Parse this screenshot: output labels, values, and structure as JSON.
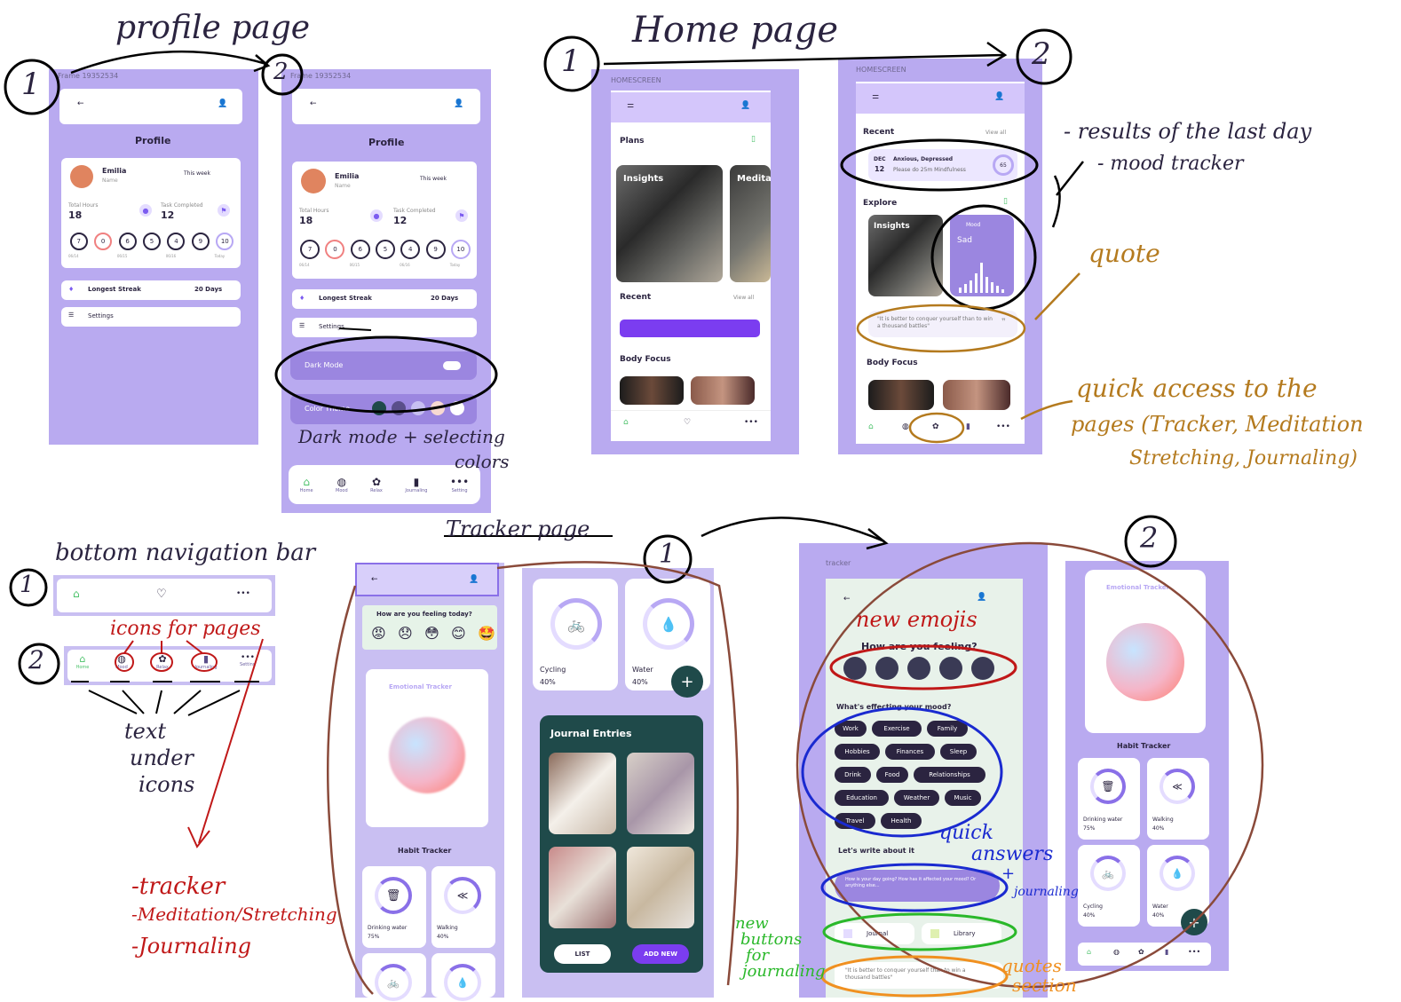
{
  "annotations": {
    "profile_page": "profile page",
    "home_page": "Home page",
    "tracker_page": "Tracker page",
    "bottom_nav_bar": "bottom navigation bar",
    "step1": "1",
    "step2": "2",
    "results_last_day": "- results of the last day",
    "mood_tracker": "- mood tracker",
    "quote": "quote",
    "quick_access": [
      "quick access to the",
      "pages (Tracker, Meditation",
      "Stretching, Journaling)"
    ],
    "dark_mode_colors": [
      "Dark mode + selecting",
      "colors"
    ],
    "icons_for_pages": "icons for pages",
    "text_under_icons": [
      "text",
      "under",
      "icons"
    ],
    "pages_list": [
      "-tracker",
      "-Meditation/Stretching",
      "-Journaling"
    ],
    "new_emojis": "new emojis",
    "quick_answers": [
      "quick",
      "answers",
      "+",
      "journaling"
    ],
    "new_buttons": [
      "new",
      "buttons",
      "for",
      "journaling"
    ],
    "quotes_section": [
      "quotes",
      "section"
    ]
  },
  "profile1": {
    "frame_label": "Frame 19352534",
    "title": "Profile",
    "name": "Emilia",
    "name_sub": "Name",
    "period": "This week",
    "hours_label": "Total Hours",
    "hours": "18",
    "tasks_label": "Task Completed",
    "tasks": "12",
    "days": [
      "7",
      "0",
      "6",
      "5",
      "4",
      "9",
      "10"
    ],
    "dates": [
      "06/14",
      "",
      "06/15",
      "",
      "06/16",
      "",
      "Today"
    ],
    "streak_label": "Longest Streak",
    "streak_value": "20 Days",
    "settings": "Settings"
  },
  "profile2": {
    "frame_label": "Frame 19352534",
    "title": "Profile",
    "name": "Emilia",
    "name_sub": "Name",
    "period": "This week",
    "hours_label": "Total Hours",
    "hours": "18",
    "tasks_label": "Task Completed",
    "tasks": "12",
    "days": [
      "7",
      "0",
      "6",
      "5",
      "4",
      "9",
      "10"
    ],
    "dates": [
      "06/14",
      "",
      "06/15",
      "",
      "06/16",
      "",
      "Today"
    ],
    "streak_label": "Longest Streak",
    "streak_value": "20 Days",
    "settings": "Settings",
    "dark_mode": "Dark Mode",
    "color_theme": "Color Theme",
    "theme_colors": [
      "#1f4a4a",
      "#5a4e8a",
      "#c7bff2",
      "#f7d9d2",
      "#ffffff"
    ],
    "nav": [
      "Home",
      "Mood",
      "Relax",
      "Journaling",
      "Setting"
    ]
  },
  "home1": {
    "frame_label": "HOMESCREEN",
    "plans": "Plans",
    "insights": "Insights",
    "meditate": "Medita",
    "recent": "Recent",
    "view_all": "View all",
    "body_focus": "Body Focus"
  },
  "home2": {
    "frame_label": "HOMESCREEN",
    "recent": "Recent",
    "view_all": "View all",
    "month": "DEC",
    "day": "12",
    "mood_title": "Anxious, Depressed",
    "mood_sub": "Please do 25m Mindfulness",
    "score": "65",
    "explore": "Explore",
    "insights": "Insights",
    "mood_label": "Mood",
    "mood_value": "Sad",
    "quote": "\"It is better to conquer yourself than to win a thousand battles\"",
    "body_focus": "Body Focus"
  },
  "tracker1": {
    "question": "How are you feeling today?",
    "emotional_tracker": "Emotional Tracker",
    "habit_tracker": "Habit Tracker",
    "drinking": "Drinking water",
    "drinking_pct": "75%",
    "walking": "Walking",
    "walking_pct": "40%",
    "cycling": "Cycling",
    "cycling_pct": "40%",
    "water": "Water",
    "water_pct": "40%",
    "journal_entries": "Journal Entries",
    "list": "LIST",
    "add_new": "ADD NEW"
  },
  "tracker2": {
    "frame_label": "tracker",
    "question": "How are you feeling?",
    "effect_q": "What's effecting your mood?",
    "chips": [
      "Work",
      "Exercise",
      "Family",
      "Hobbies",
      "Finances",
      "Sleep",
      "Drink",
      "Food",
      "Relationships",
      "Education",
      "Weather",
      "Music",
      "Travel",
      "Health"
    ],
    "write": "Let's write about it",
    "write_placeholder": "How is your day going? How has it affected your mood? Or anything else...",
    "journal": "Journal",
    "library": "Library",
    "quote": "\"It is better to conquer yourself than to win a thousand battles\"",
    "emotional_tracker": "Emotional Tracker",
    "habit_tracker": "Habit Tracker",
    "drinking": "Drinking water",
    "drinking_pct": "75%",
    "walking": "Walking",
    "walking_pct": "40%",
    "cycling": "Cycling",
    "cycling_pct": "40%",
    "water": "Water",
    "water_pct": "40%"
  },
  "navbar": {
    "home": "Home",
    "mood": "Mood",
    "relax": "Relax",
    "journaling": "Journaling",
    "setting": "Setting"
  }
}
